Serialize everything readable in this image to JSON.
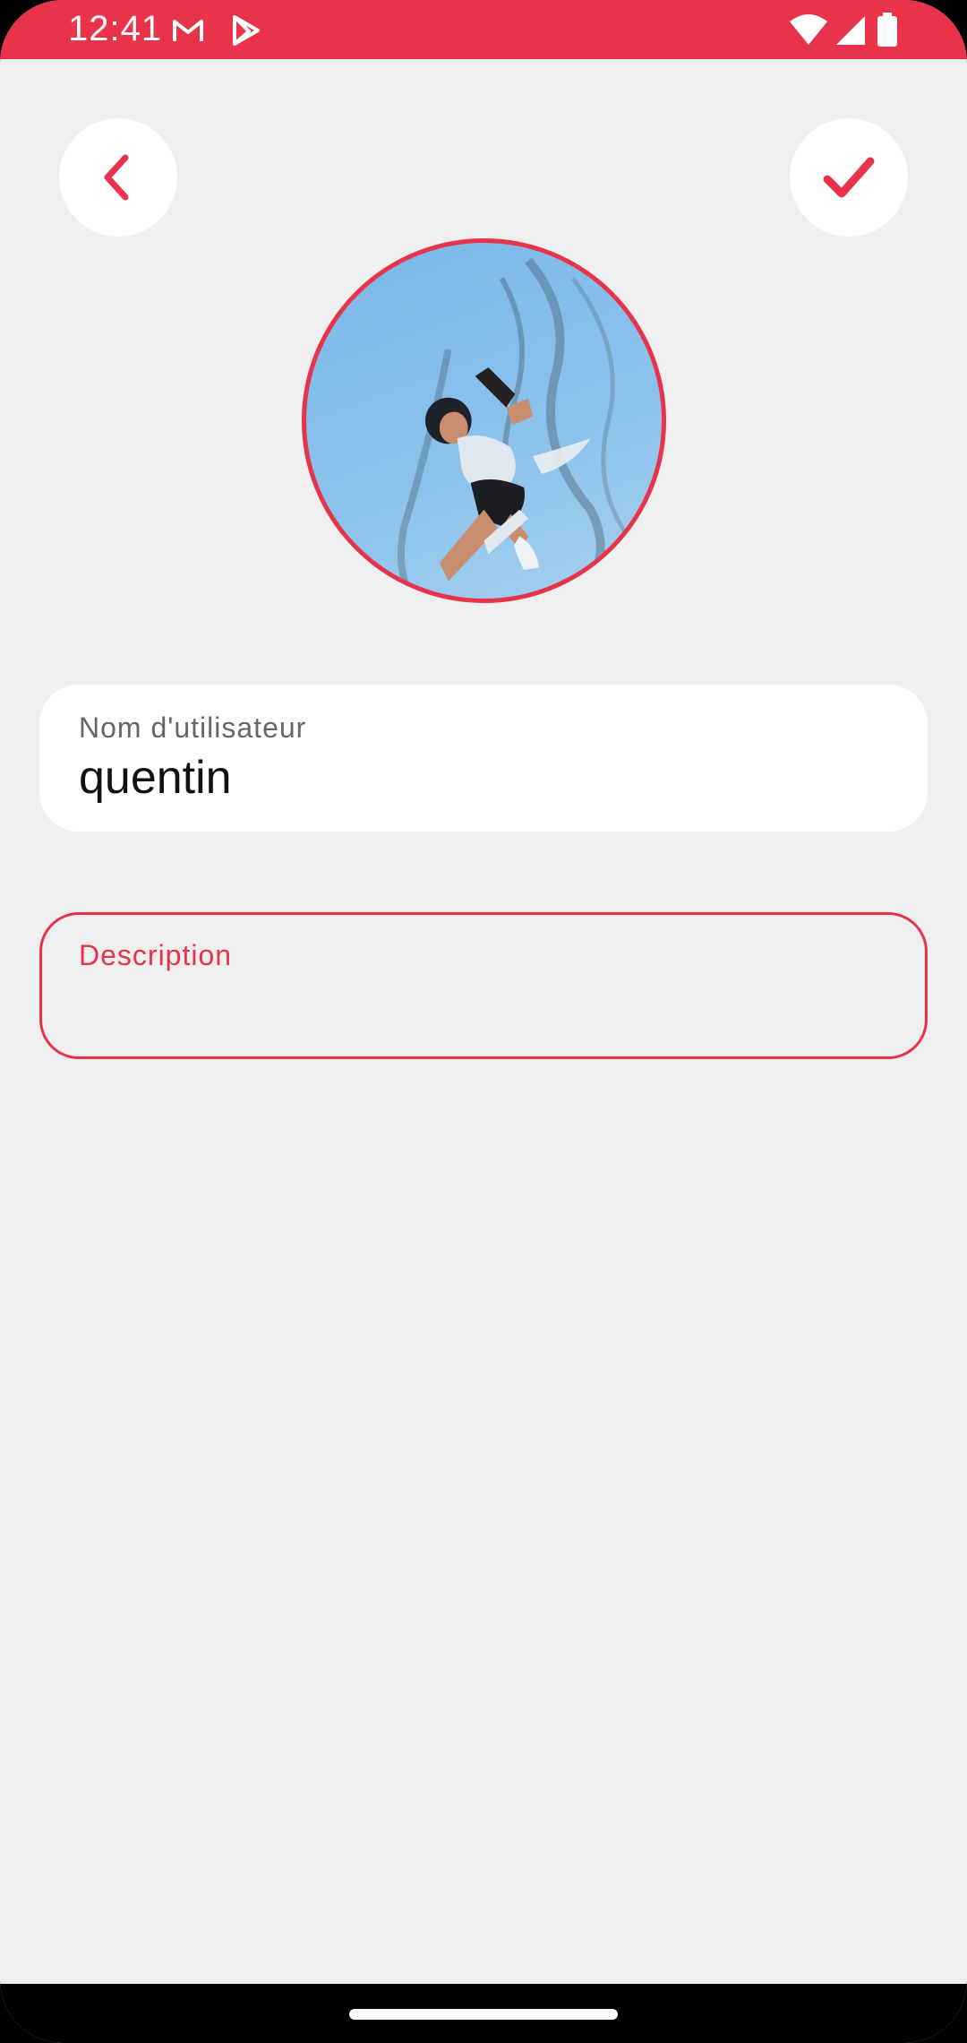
{
  "status_bar": {
    "time": "12:41",
    "icons": [
      "gmail-icon",
      "play-store-icon",
      "wifi-icon",
      "signal-icon",
      "battery-icon"
    ],
    "color": "#e8334a"
  },
  "toolbar": {
    "back_icon": "chevron-left-icon",
    "confirm_icon": "checkmark-icon",
    "accent_color": "#e8334a"
  },
  "profile": {
    "avatar_icon": "profile-avatar-image"
  },
  "form": {
    "username": {
      "label": "Nom d'utilisateur",
      "value": "quentin"
    },
    "description": {
      "label": "Description",
      "value": ""
    }
  }
}
